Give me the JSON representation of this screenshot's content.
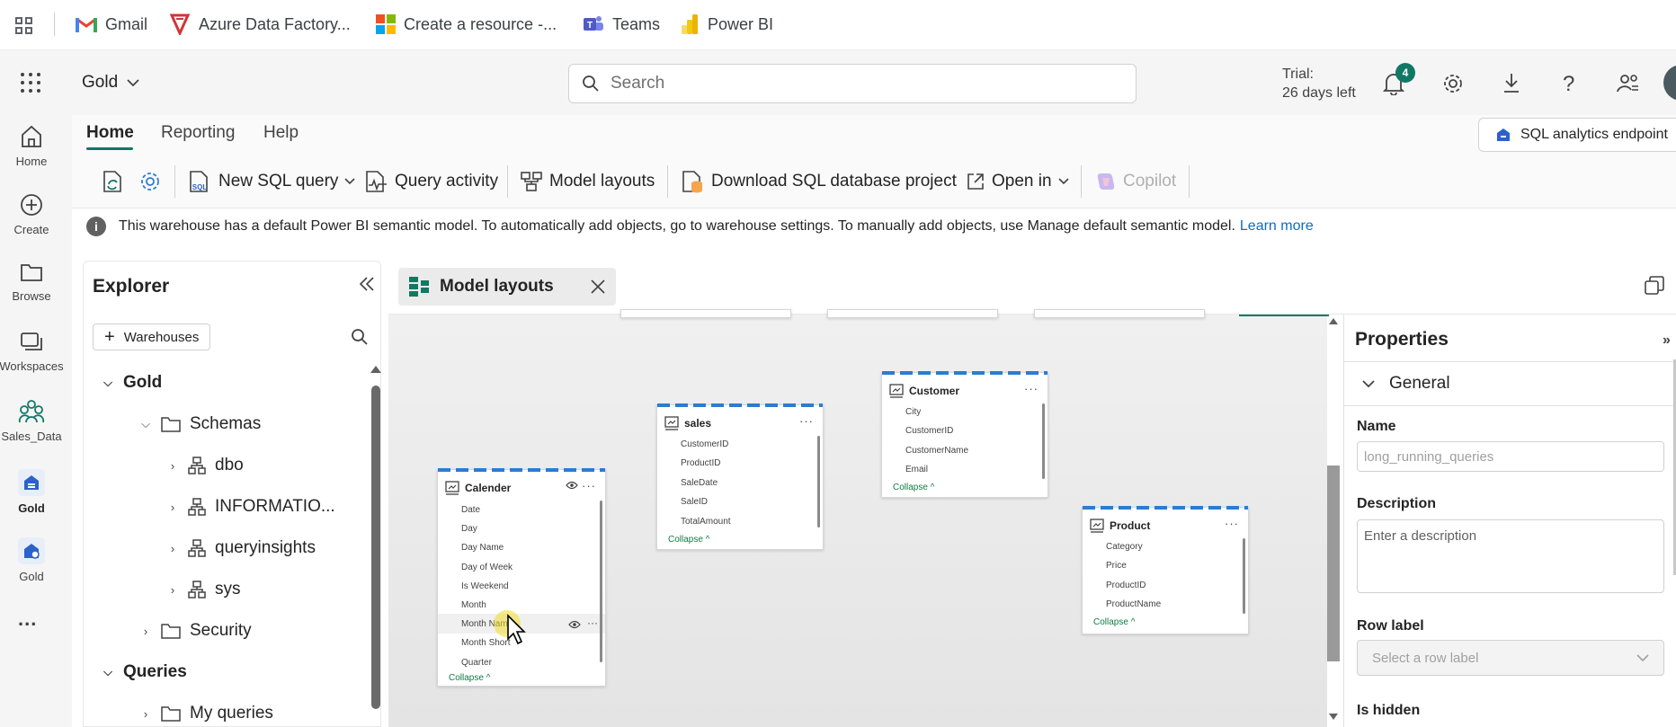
{
  "bookmarks": {
    "items": [
      {
        "label": "Gmail",
        "icon": "gmail-icon"
      },
      {
        "label": "Azure Data Factory...",
        "icon": "azure-data-factory-icon"
      },
      {
        "label": "Create a resource -...",
        "icon": "microsoft-icon"
      },
      {
        "label": "Teams",
        "icon": "teams-icon"
      },
      {
        "label": "Power BI",
        "icon": "power-bi-icon"
      }
    ]
  },
  "header": {
    "workspace": "Gold",
    "search_placeholder": "Search",
    "trial_line1": "Trial:",
    "trial_line2": "26 days left",
    "notification_count": "4"
  },
  "rail": {
    "items": [
      {
        "label": "Home",
        "icon": "home-icon"
      },
      {
        "label": "Create",
        "icon": "create-icon"
      },
      {
        "label": "Browse",
        "icon": "browse-icon"
      },
      {
        "label": "Workspaces",
        "icon": "workspaces-icon"
      },
      {
        "label": "Sales_Data",
        "icon": "sales-data-icon"
      },
      {
        "label": "Gold",
        "icon": "warehouse-icon"
      },
      {
        "label": "Gold",
        "icon": "warehouse-icon"
      }
    ],
    "more": "..."
  },
  "ribbon": {
    "tabs": [
      "Home",
      "Reporting",
      "Help"
    ],
    "endpoint": "SQL analytics endpoint",
    "toolbar": {
      "new_sql_query": "New SQL query",
      "query_activity": "Query activity",
      "model_layouts": "Model layouts",
      "download_project": "Download SQL database project",
      "open_in": "Open in",
      "copilot": "Copilot"
    }
  },
  "info_banner": {
    "text": "This warehouse has a default Power BI semantic model. To automatically add objects, go to warehouse settings. To manually add objects, use Manage default semantic model.",
    "link": "Learn more"
  },
  "explorer": {
    "title": "Explorer",
    "add_button": "Warehouses",
    "tree": {
      "gold": "Gold",
      "schemas": "Schemas",
      "dbo": "dbo",
      "information": "INFORMATIO...",
      "queryinsights": "queryinsights",
      "sys": "sys",
      "security": "Security",
      "queries": "Queries",
      "my_queries": "My queries"
    }
  },
  "editor_tab": {
    "label": "Model layouts"
  },
  "model": {
    "collapse_label": "Collapse",
    "tables": {
      "calender": {
        "name": "Calender",
        "columns": [
          "Date",
          "Day",
          "Day Name",
          "Day of Week",
          "Is Weekend",
          "Month",
          "Month Name",
          "Month Short",
          "Quarter"
        ]
      },
      "sales": {
        "name": "sales",
        "columns": [
          "CustomerID",
          "ProductID",
          "SaleDate",
          "SaleID",
          "TotalAmount"
        ]
      },
      "customer": {
        "name": "Customer",
        "columns": [
          "City",
          "CustomerID",
          "CustomerName",
          "Email"
        ]
      },
      "product": {
        "name": "Product",
        "columns": [
          "Category",
          "Price",
          "ProductID",
          "ProductName"
        ]
      }
    }
  },
  "properties": {
    "title": "Properties",
    "section": "General",
    "name_label": "Name",
    "name_value": "long_running_queries",
    "description_label": "Description",
    "description_placeholder": "Enter a description",
    "row_label_label": "Row label",
    "row_label_placeholder": "Select a row label",
    "is_hidden_label": "Is hidden"
  },
  "colors": {
    "accent": "#117865",
    "link": "#0f6cbd",
    "stripe": "#2b7cd3"
  }
}
